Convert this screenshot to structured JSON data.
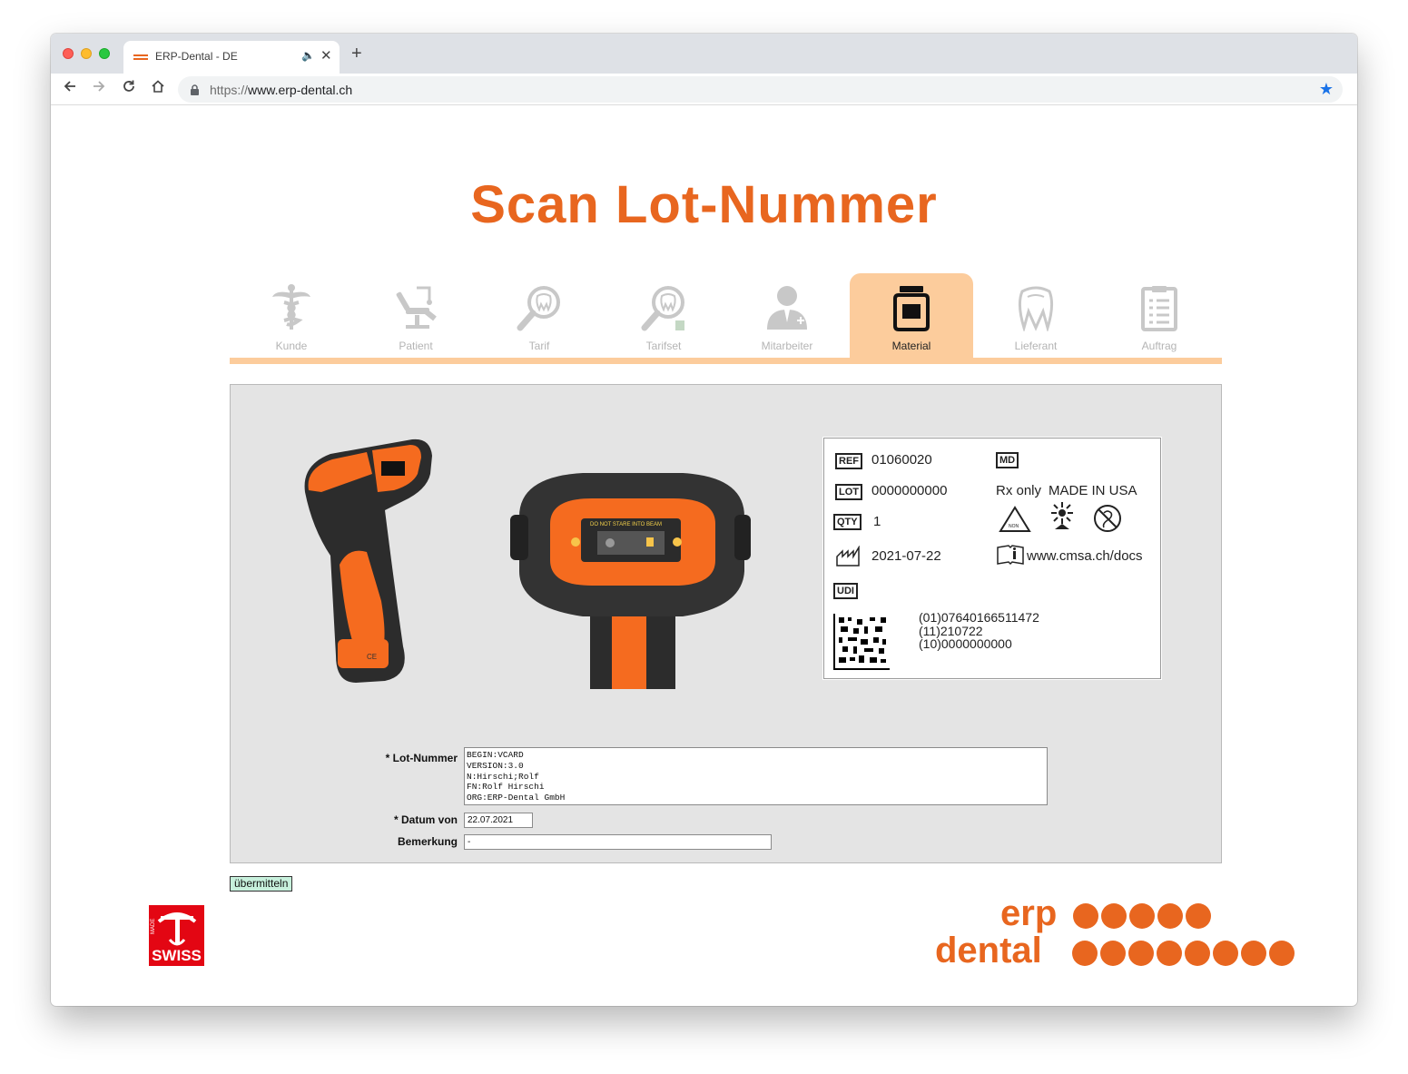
{
  "browser": {
    "tab_title": "ERP-Dental - DE",
    "url_scheme": "https://",
    "url_host": "www.erp-dental.ch"
  },
  "page": {
    "title": "Scan Lot-Nummer"
  },
  "nav_tabs": [
    {
      "label": "Kunde",
      "icon": "caduceus-icon",
      "active": false
    },
    {
      "label": "Patient",
      "icon": "dental-chair-icon",
      "active": false
    },
    {
      "label": "Tarif",
      "icon": "tooth-search-icon",
      "active": false
    },
    {
      "label": "Tarifset",
      "icon": "tooth-search-calculator-icon",
      "active": false
    },
    {
      "label": "Mitarbeiter",
      "icon": "staff-person-icon",
      "active": false
    },
    {
      "label": "Material",
      "icon": "material-jar-icon",
      "active": true
    },
    {
      "label": "Lieferant",
      "icon": "tooth-outline-icon",
      "active": false
    },
    {
      "label": "Auftrag",
      "icon": "clipboard-icon",
      "active": false
    }
  ],
  "product_label": {
    "ref_symbol": "REF",
    "ref_value": "01060020",
    "md_symbol": "MD",
    "lot_symbol": "LOT",
    "lot_value": "0000000000",
    "rx_only": "Rx only",
    "made_in": "MADE IN USA",
    "qty_symbol": "QTY",
    "qty_value": "1",
    "date_value": "2021-07-22",
    "docs_url": "www.cmsa.ch/docs",
    "udi_symbol": "UDI",
    "udi_lines": [
      "(01)07640166511472",
      "(11)210722",
      "(10)0000000000"
    ]
  },
  "form": {
    "lot_label": "* Lot-Nummer",
    "lot_value": "BEGIN:VCARD\nVERSION:3.0\nN:Hirschi;Rolf\nFN:Rolf Hirschi\nORG:ERP-Dental GmbH",
    "datum_label": "* Datum von",
    "datum_value": "22.07.2021",
    "bemerkung_label": "Bemerkung",
    "bemerkung_value": "-",
    "submit_label": "übermitteln"
  },
  "footer": {
    "swiss_text": "SWISS",
    "swiss_made": "MADE",
    "brand_line1": "erp",
    "brand_line2": "dental"
  },
  "colors": {
    "accent": "#e8661f",
    "tab_active_bg": "#fccc9c",
    "panel_bg": "#e4e4e4",
    "submit_bg": "#c7f0dc",
    "swiss_red": "#e30613"
  }
}
